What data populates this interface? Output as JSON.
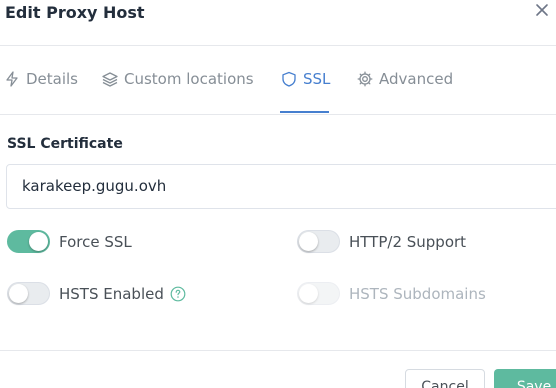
{
  "modal": {
    "title": "Edit Proxy Host"
  },
  "tabs": [
    {
      "label": "Details",
      "icon": "zap-icon",
      "active": false
    },
    {
      "label": "Custom locations",
      "icon": "layers-icon",
      "active": false
    },
    {
      "label": "SSL",
      "icon": "shield-icon",
      "active": true
    },
    {
      "label": "Advanced",
      "icon": "gear-icon",
      "active": false
    }
  ],
  "ssl": {
    "certificate_label": "SSL Certificate",
    "certificate_value": "karakeep.gugu.ovh",
    "options": {
      "force_ssl": {
        "label": "Force SSL",
        "enabled": true
      },
      "http2_support": {
        "label": "HTTP/2 Support",
        "enabled": false
      },
      "hsts_enabled": {
        "label": "HSTS Enabled",
        "enabled": false
      },
      "hsts_subdomains": {
        "label": "HSTS Subdomains",
        "enabled": false,
        "disabled": true
      }
    }
  },
  "footer": {
    "cancel_label": "Cancel",
    "save_label": "Save"
  },
  "colors": {
    "accent": "#467fcf",
    "toggle_on": "#5eba9f",
    "muted_text": "#868e96"
  }
}
